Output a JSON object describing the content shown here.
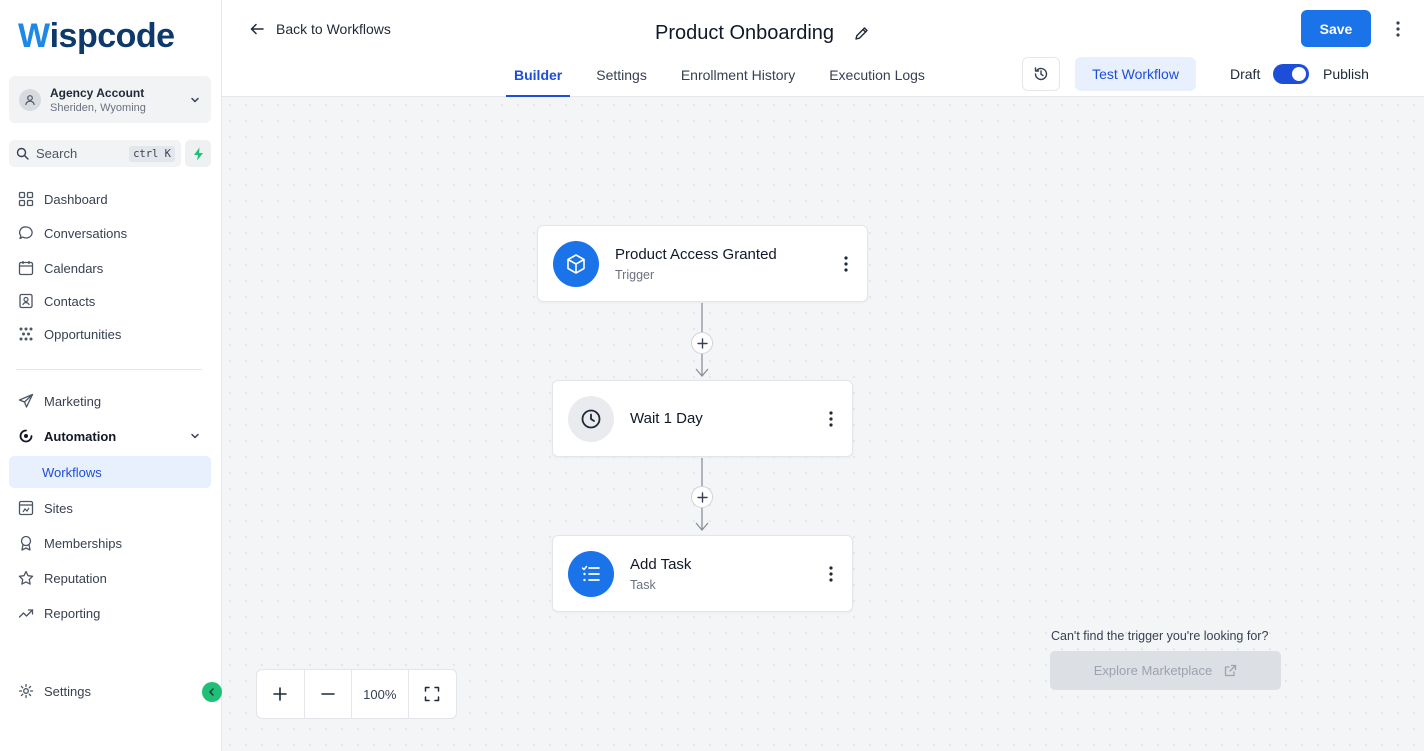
{
  "brand": {
    "logo_first": "W",
    "logo_rest": "ispcode"
  },
  "account": {
    "name": "Agency Account",
    "location": "Sheriden, Wyoming"
  },
  "search": {
    "label": "Search",
    "shortcut": "ctrl K"
  },
  "sidebar": {
    "items": [
      {
        "label": "Dashboard",
        "icon": "grid-icon"
      },
      {
        "label": "Conversations",
        "icon": "chat-bubble-icon"
      },
      {
        "label": "Calendars",
        "icon": "calendar-icon"
      },
      {
        "label": "Contacts",
        "icon": "contact-card-icon"
      },
      {
        "label": "Opportunities",
        "icon": "network-icon"
      },
      {
        "label": "Marketing",
        "icon": "send-icon"
      },
      {
        "label": "Automation",
        "icon": "automation-icon"
      },
      {
        "label": "Workflows",
        "icon": ""
      },
      {
        "label": "Sites",
        "icon": "site-icon"
      },
      {
        "label": "Memberships",
        "icon": "badge-icon"
      },
      {
        "label": "Reputation",
        "icon": "star-icon"
      },
      {
        "label": "Reporting",
        "icon": "trend-icon"
      },
      {
        "label": "Settings",
        "icon": "gear-icon"
      }
    ]
  },
  "header": {
    "back_label": "Back to Workflows",
    "title": "Product Onboarding",
    "tabs": [
      {
        "label": "Builder"
      },
      {
        "label": "Settings"
      },
      {
        "label": "Enrollment History"
      },
      {
        "label": "Execution Logs"
      }
    ],
    "test_label": "Test Workflow",
    "draft_label": "Draft",
    "publish_label": "Publish",
    "save_label": "Save"
  },
  "workflow": {
    "nodes": [
      {
        "title": "Product Access Granted",
        "subtitle": "Trigger",
        "icon": "cube-icon"
      },
      {
        "title": "Wait 1 Day",
        "subtitle": "",
        "icon": "clock-icon"
      },
      {
        "title": "Add Task",
        "subtitle": "Task",
        "icon": "task-list-icon"
      }
    ]
  },
  "zoom": {
    "level": "100%"
  },
  "marketplace": {
    "prompt": "Can't find the trigger you're looking for?",
    "button_label": "Explore Marketplace"
  },
  "colors": {
    "accent": "#1a73e8",
    "active_bg": "#e8f0fe",
    "collapse": "#1fbf75"
  }
}
